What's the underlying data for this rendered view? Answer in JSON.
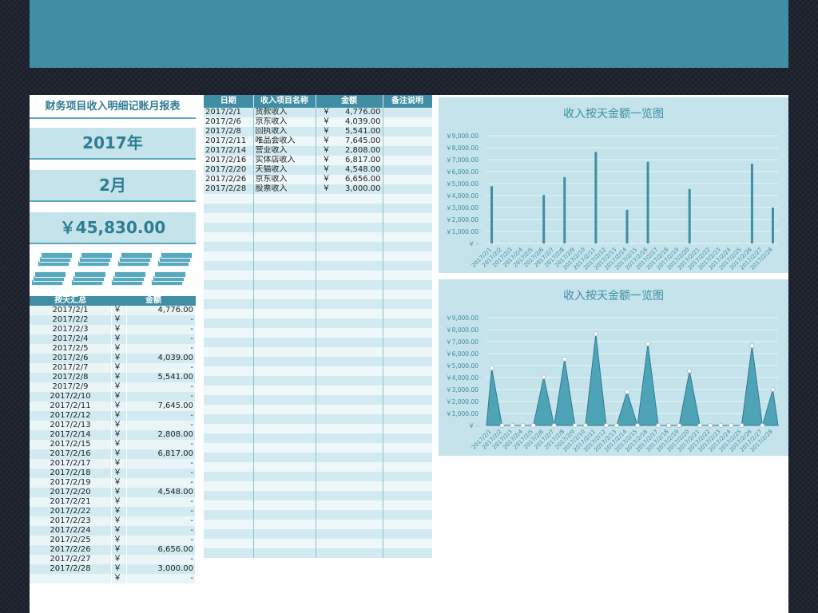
{
  "report": {
    "title": "财务项目收入明细记账月报表",
    "year": "2017年",
    "month": "2月",
    "total": "￥45,830.00"
  },
  "summary": {
    "headers": [
      "按天汇总",
      "金额"
    ],
    "currency": "￥",
    "rows": [
      {
        "date": "2017/2/1",
        "amount": "4,776.00"
      },
      {
        "date": "2017/2/2",
        "amount": "-"
      },
      {
        "date": "2017/2/3",
        "amount": "-"
      },
      {
        "date": "2017/2/4",
        "amount": "-"
      },
      {
        "date": "2017/2/5",
        "amount": "-"
      },
      {
        "date": "2017/2/6",
        "amount": "4,039.00"
      },
      {
        "date": "2017/2/7",
        "amount": "-"
      },
      {
        "date": "2017/2/8",
        "amount": "5,541.00"
      },
      {
        "date": "2017/2/9",
        "amount": "-"
      },
      {
        "date": "2017/2/10",
        "amount": "-"
      },
      {
        "date": "2017/2/11",
        "amount": "7,645.00"
      },
      {
        "date": "2017/2/12",
        "amount": "-"
      },
      {
        "date": "2017/2/13",
        "amount": "-"
      },
      {
        "date": "2017/2/14",
        "amount": "2,808.00"
      },
      {
        "date": "2017/2/15",
        "amount": "-"
      },
      {
        "date": "2017/2/16",
        "amount": "6,817.00"
      },
      {
        "date": "2017/2/17",
        "amount": "-"
      },
      {
        "date": "2017/2/18",
        "amount": "-"
      },
      {
        "date": "2017/2/19",
        "amount": "-"
      },
      {
        "date": "2017/2/20",
        "amount": "4,548.00"
      },
      {
        "date": "2017/2/21",
        "amount": "-"
      },
      {
        "date": "2017/2/22",
        "amount": "-"
      },
      {
        "date": "2017/2/23",
        "amount": "-"
      },
      {
        "date": "2017/2/24",
        "amount": "-"
      },
      {
        "date": "2017/2/25",
        "amount": "-"
      },
      {
        "date": "2017/2/26",
        "amount": "6,656.00"
      },
      {
        "date": "2017/2/27",
        "amount": "-"
      },
      {
        "date": "2017/2/28",
        "amount": "3,000.00"
      },
      {
        "date": "",
        "amount": "-"
      }
    ]
  },
  "detail": {
    "headers": [
      "日期",
      "收入项目名称",
      "金额",
      "备注说明"
    ],
    "currency": "￥",
    "rows": [
      {
        "date": "2017/2/1",
        "item": "货款收入",
        "amount": "4,776.00",
        "note": ""
      },
      {
        "date": "2017/2/6",
        "item": "京东收入",
        "amount": "4,039.00",
        "note": ""
      },
      {
        "date": "2017/2/8",
        "item": "回执收入",
        "amount": "5,541.00",
        "note": ""
      },
      {
        "date": "2017/2/11",
        "item": "唯品会收入",
        "amount": "7,645.00",
        "note": ""
      },
      {
        "date": "2017/2/14",
        "item": "营业收入",
        "amount": "2,808.00",
        "note": ""
      },
      {
        "date": "2017/2/16",
        "item": "实体店收入",
        "amount": "6,817.00",
        "note": ""
      },
      {
        "date": "2017/2/20",
        "item": "天猫收入",
        "amount": "4,548.00",
        "note": ""
      },
      {
        "date": "2017/2/26",
        "item": "京东收入",
        "amount": "6,656.00",
        "note": ""
      },
      {
        "date": "2017/2/28",
        "item": "股票收入",
        "amount": "3,000.00",
        "note": ""
      }
    ],
    "empty_rows": 38
  },
  "chart_data": [
    {
      "type": "bar",
      "title": "收入按天金额一览图",
      "categories": [
        "2017/2/1",
        "2017/2/2",
        "2017/2/3",
        "2017/2/4",
        "2017/2/5",
        "2017/2/6",
        "2017/2/7",
        "2017/2/8",
        "2017/2/9",
        "2017/2/10",
        "2017/2/11",
        "2017/2/12",
        "2017/2/13",
        "2017/2/14",
        "2017/2/15",
        "2017/2/16",
        "2017/2/17",
        "2017/2/18",
        "2017/2/19",
        "2017/2/20",
        "2017/2/21",
        "2017/2/22",
        "2017/2/23",
        "2017/2/24",
        "2017/2/25",
        "2017/2/26",
        "2017/2/27",
        "2017/2/28"
      ],
      "values": [
        4776,
        0,
        0,
        0,
        0,
        4039,
        0,
        5541,
        0,
        0,
        7645,
        0,
        0,
        2808,
        0,
        6817,
        0,
        0,
        0,
        4548,
        0,
        0,
        0,
        0,
        0,
        6656,
        0,
        3000
      ],
      "yticks": [
        "￥9,000.00",
        "￥8,000.00",
        "￥7,000.00",
        "￥6,000.00",
        "￥5,000.00",
        "￥4,000.00",
        "￥3,000.00",
        "￥2,000.00",
        "￥1,000.00",
        "￥ -"
      ],
      "ylim": [
        0,
        9000
      ],
      "grid": true,
      "color": "#3f8ea4"
    },
    {
      "type": "area",
      "title": "收入按天金额一览图",
      "categories": [
        "2017/2/1",
        "2017/2/2",
        "2017/2/3",
        "2017/2/4",
        "2017/2/5",
        "2017/2/6",
        "2017/2/7",
        "2017/2/8",
        "2017/2/9",
        "2017/2/10",
        "2017/2/11",
        "2017/2/12",
        "2017/2/13",
        "2017/2/14",
        "2017/2/15",
        "2017/2/16",
        "2017/2/17",
        "2017/2/18",
        "2017/2/19",
        "2017/2/20",
        "2017/2/21",
        "2017/2/22",
        "2017/2/23",
        "2017/2/24",
        "2017/2/25",
        "2017/2/26",
        "2017/2/27",
        "2017/2/28"
      ],
      "values": [
        4776,
        0,
        0,
        0,
        0,
        4039,
        0,
        5541,
        0,
        0,
        7645,
        0,
        0,
        2808,
        0,
        6817,
        0,
        0,
        0,
        4548,
        0,
        0,
        0,
        0,
        0,
        6656,
        0,
        3000
      ],
      "yticks": [
        "￥9,000.00",
        "￥8,000.00",
        "￥7,000.00",
        "￥6,000.00",
        "￥5,000.00",
        "￥4,000.00",
        "￥3,000.00",
        "￥2,000.00",
        "￥1,000.00",
        "￥ -"
      ],
      "ylim": [
        0,
        9000
      ],
      "grid": true,
      "color": "#4fa3b6"
    }
  ]
}
